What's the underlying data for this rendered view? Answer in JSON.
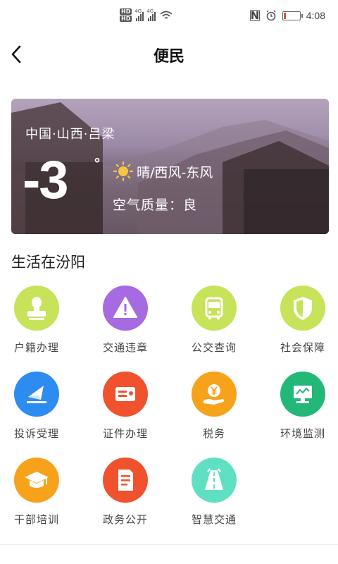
{
  "status_bar": {
    "hd_labels": [
      "HD",
      "HD"
    ],
    "network_labels": [
      "4G",
      "4G"
    ],
    "icons": [
      "hd-icon",
      "signal-icon",
      "signal-icon",
      "wifi-icon",
      "nfc-icon",
      "alarm-icon",
      "battery-icon"
    ],
    "nfc": "N",
    "time": "4:08",
    "battery_level_fraction": 0.15,
    "battery_color": "#e94c2b"
  },
  "header": {
    "title": "便民",
    "back_icon": "chevron-left-icon"
  },
  "weather": {
    "location": "中国·山西·吕梁",
    "temperature": "-3",
    "degree": "°",
    "condition": "晴/西风-东风",
    "condition_icon": "sun-icon",
    "air_quality": "空气质量：良"
  },
  "section": {
    "title": "生活在汾阳"
  },
  "services": [
    {
      "label": "户籍办理",
      "icon": "stamp-icon",
      "color": "#c6e35a"
    },
    {
      "label": "交通违章",
      "icon": "warning-icon",
      "color": "#a66be0"
    },
    {
      "label": "公交查询",
      "icon": "bus-icon",
      "color": "#c6e35a"
    },
    {
      "label": "社会保障",
      "icon": "shield-icon",
      "color": "#c6e35a"
    },
    {
      "label": "投诉受理",
      "icon": "paper-plane-icon",
      "color": "#2d8cf0"
    },
    {
      "label": "证件办理",
      "icon": "id-card-icon",
      "color": "#f0522e"
    },
    {
      "label": "税务",
      "icon": "yuan-hand-icon",
      "color": "#f7a21b"
    },
    {
      "label": "环境监测",
      "icon": "monitor-icon",
      "color": "#23b877"
    },
    {
      "label": "干部培训",
      "icon": "graduation-cap-icon",
      "color": "#f7a21b"
    },
    {
      "label": "政务公开",
      "icon": "document-icon",
      "color": "#f0522e"
    },
    {
      "label": "智慧交通",
      "icon": "road-icon",
      "color": "#5fe0c3"
    }
  ]
}
